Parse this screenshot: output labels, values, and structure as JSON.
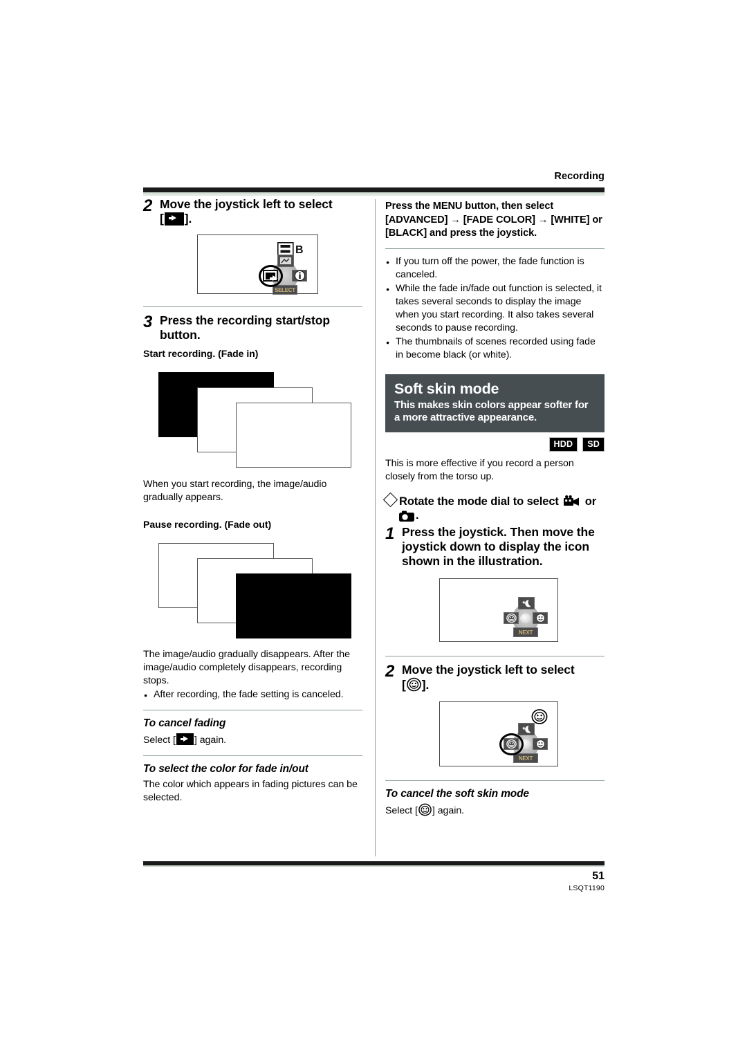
{
  "header": {
    "section_title": "Recording"
  },
  "left_column": {
    "step2": {
      "number": "2",
      "text_before_icon": "Move the joystick left to select",
      "bracket_open": "[",
      "icon": "fade-icon",
      "bracket_close": "].",
      "illustration": "joystick-lcd-fade"
    },
    "step3": {
      "number": "3",
      "text": "Press the recording start/stop button.",
      "caption": "Start recording. (Fade in)"
    },
    "fade_in_note": "When you start recording, the image/audio gradually appears.",
    "fade_out_caption": "Pause recording. (Fade out)",
    "fade_out_note": "The image/audio gradually disappears. After the image/audio completely disappears, recording stops.",
    "fade_out_bullets": [
      "After recording, the fade setting is canceled."
    ],
    "cancel_fading": {
      "title": "To cancel fading",
      "text_before": "Select [",
      "icon": "fade-icon",
      "text_after": "] again."
    },
    "fade_color": {
      "title": "To select the color for fade in/out",
      "body": "The color which appears in fading pictures can be selected."
    }
  },
  "right_column": {
    "menu_instruction_lines": [
      "Press the MENU button, then select",
      "[ADVANCED] → [FADE COLOR] → [WHITE] or",
      "[BLACK] and press the joystick."
    ],
    "notes": [
      "If you turn off the power, the fade function is canceled.",
      "While the fade in/fade out function is selected, it takes several seconds to display the image when you start recording. It also takes several seconds to pause recording.",
      "The thumbnails of scenes recorded using fade in become black (or white)."
    ],
    "callout": {
      "title": "Soft skin mode",
      "subtitle": "This makes skin colors appear softer for a more attractive appearance."
    },
    "badges": [
      "HDD",
      "SD"
    ],
    "intro": "This is more effective if you record a person closely from the torso up.",
    "mode_dial": {
      "text_before": "Rotate the mode dial to select",
      "icon_1": "camcorder-icon",
      "conjunction": "or",
      "icon_2": "photo-camera-icon",
      "period": "."
    },
    "step1": {
      "number": "1",
      "text": "Press the joystick. Then move the joystick down to display the icon shown in the illustration.",
      "illustration": "joystick-lcd-menu"
    },
    "step2": {
      "number": "2",
      "text_before_icon": "Move the joystick left to select",
      "bracket_open": "[",
      "icon": "soft-skin-icon",
      "bracket_close": "].",
      "illustration": "joystick-lcd-softskin-selected"
    },
    "cancel_soft_skin": {
      "title": "To cancel the soft skin mode",
      "text_before": "Select [",
      "icon": "soft-skin-icon",
      "text_after": "] again."
    },
    "joystick_labels": {
      "down_tile": "SELECT",
      "down_tile_alt": "NEXT"
    }
  },
  "footer": {
    "page_number": "51",
    "document_code": "LSQT1190"
  },
  "colors": {
    "callout_bg": "#474e52",
    "rule_dark": "#1a1a1a",
    "rule_light": "#cfdbd3",
    "divider": "#9aa3a0"
  }
}
